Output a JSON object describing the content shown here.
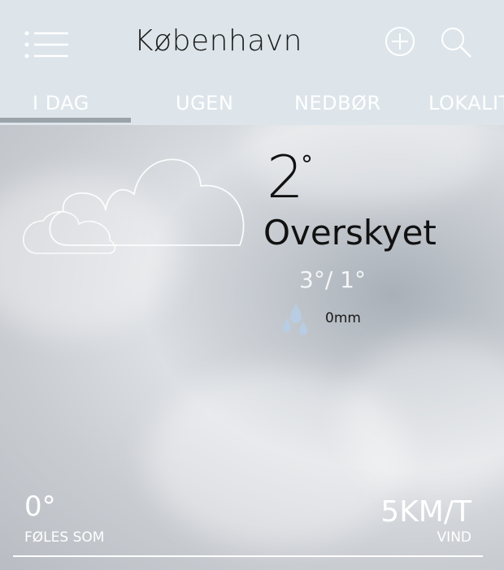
{
  "header": {
    "city": "København",
    "icons": [
      "menu-icon",
      "add-icon",
      "search-icon"
    ]
  },
  "tabs": [
    {
      "label": "I DAG",
      "active": true
    },
    {
      "label": "UGEN",
      "active": false
    },
    {
      "label": "NEDBØR",
      "active": false
    },
    {
      "label": "LOKALIT",
      "active": false
    }
  ],
  "current": {
    "temperature": "2",
    "degree_symbol": "°",
    "condition": "Overskyet",
    "high_low": "3°/ 1°",
    "precipitation": "0mm",
    "icon": "cloudy-icon"
  },
  "footer": {
    "feels_value": "0°",
    "feels_label": "FØLES SOM",
    "wind_value": "5KM/T",
    "wind_label": "VIND"
  },
  "colors": {
    "header_bg": "#dde5ea",
    "tab_indicator": "#9aa3a9",
    "icon_blue": "#b8cde3"
  }
}
